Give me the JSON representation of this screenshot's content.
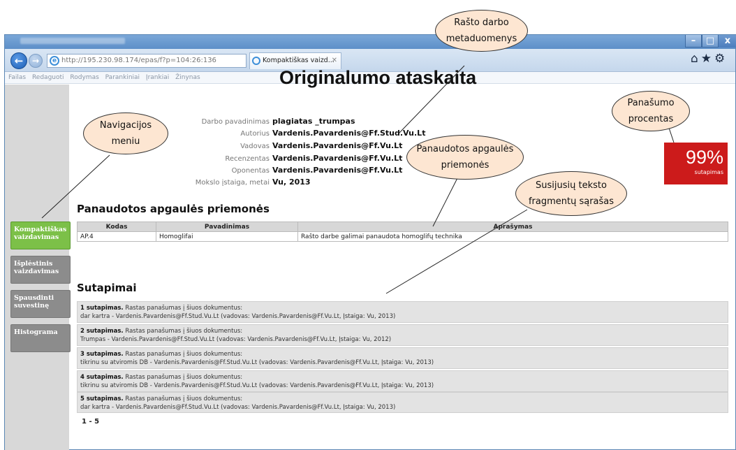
{
  "browser": {
    "address": "http://195.230.98.174/epas/f?p=104:26:136",
    "address_host": "195.230.98.174",
    "tab_title": "Kompaktiškas vaizd...",
    "menu": [
      "Failas",
      "Redaguoti",
      "Rodymas",
      "Parankiniai",
      "Įrankiai",
      "Žinynas"
    ]
  },
  "sidebar": {
    "items": [
      {
        "label": "Kompaktiškas vaizdavimas",
        "active": true
      },
      {
        "label": "Išplėstinis vaizdavimas",
        "active": false
      },
      {
        "label": "Spausdinti suvestinę",
        "active": false
      },
      {
        "label": "Histograma",
        "active": false
      }
    ]
  },
  "report": {
    "title": "Originalumo ataskaita",
    "meta": [
      {
        "label": "Darbo pavadinimas",
        "value": "plagiatas _trumpas"
      },
      {
        "label": "Autorius",
        "value": "Vardenis.Pavardenis@Ff.Stud.Vu.Lt"
      },
      {
        "label": "Vadovas",
        "value": "Vardenis.Pavardenis@Ff.Vu.Lt"
      },
      {
        "label": "Recenzentas",
        "value": "Vardenis.Pavardenis@Ff.Vu.Lt"
      },
      {
        "label": "Oponentas",
        "value": "Vardenis.Pavardenis@Ff.Vu.Lt"
      },
      {
        "label": "Mokslo įstaiga, metai",
        "value": "Vu, 2013"
      }
    ],
    "score": {
      "value": "99%",
      "label": "sutapimas",
      "color": "#cc1b1b"
    }
  },
  "techniques": {
    "heading": "Panaudotos apgaulės priemonės",
    "columns": [
      "Kodas",
      "Pavadinimas",
      "Aprašymas"
    ],
    "rows": [
      [
        "AP.4",
        "Homoglifai",
        "Rašto darbe galimai panaudota homoglifų technika"
      ]
    ]
  },
  "matches": {
    "heading": "Sutapimai",
    "items": [
      {
        "title": "1 sutapimas.",
        "intro": "Rastas panašumas į šiuos dokumentus:",
        "detail": "dar kartra - Vardenis.Pavardenis@Ff.Stud.Vu.Lt (vadovas: Vardenis.Pavardenis@Ff.Vu.Lt, Įstaiga: Vu, 2013)"
      },
      {
        "title": "2 sutapimas.",
        "intro": "Rastas panašumas į šiuos dokumentus:",
        "detail": "Trumpas - Vardenis.Pavardenis@Ff.Stud.Vu.Lt (vadovas: Vardenis.Pavardenis@Ff.Vu.Lt, Įstaiga: Vu, 2012)"
      },
      {
        "title": "3 sutapimas.",
        "intro": "Rastas panašumas į šiuos dokumentus:",
        "detail": "tikrinu su atviromis DB - Vardenis.Pavardenis@Ff.Stud.Vu.Lt (vadovas: Vardenis.Pavardenis@Ff.Vu.Lt, Įstaiga: Vu, 2013)"
      },
      {
        "title": "4 sutapimas.",
        "intro": "Rastas panašumas į šiuos dokumentus:",
        "detail": "tikrinu su atviromis DB - Vardenis.Pavardenis@Ff.Stud.Vu.Lt (vadovas: Vardenis.Pavardenis@Ff.Vu.Lt, Įstaiga: Vu, 2013)"
      },
      {
        "title": "5 sutapimas.",
        "intro": "Rastas panašumas į šiuos dokumentus:",
        "detail": "dar kartra - Vardenis.Pavardenis@Ff.Stud.Vu.Lt (vadovas: Vardenis.Pavardenis@Ff.Vu.Lt, Įstaiga: Vu, 2013)"
      }
    ],
    "pager": "1 - 5"
  },
  "callouts": {
    "metadata": [
      "Rašto darbo",
      "metaduomenys"
    ],
    "navigation": [
      "Navigacijos",
      "meniu"
    ],
    "similarity": [
      "Panašumo",
      "procentas"
    ],
    "techniques": [
      "Panaudotos apgaulės",
      "priemonės"
    ],
    "fragments": [
      "Susijusių teksto",
      "fragmentų sąrašas"
    ]
  }
}
